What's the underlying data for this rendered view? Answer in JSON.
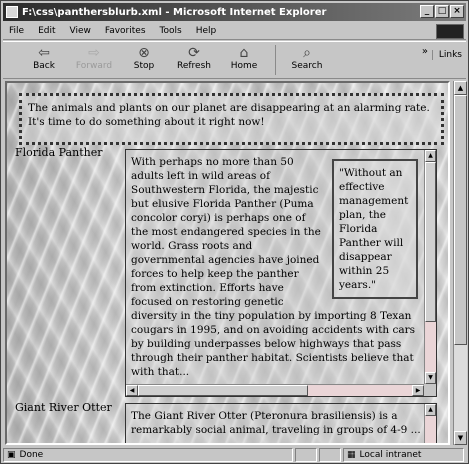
{
  "window": {
    "title": "F:\\css\\panthersblurb.xml - Microsoft Internet Explorer",
    "controls": [
      "_",
      "□",
      "×"
    ]
  },
  "menu": [
    "File",
    "Edit",
    "View",
    "Favorites",
    "Tools",
    "Help"
  ],
  "toolbar": {
    "back": "Back",
    "forward": "Forward",
    "stop": "Stop",
    "refresh": "Refresh",
    "home": "Home",
    "search": "Search",
    "more": "»",
    "links": "Links"
  },
  "page": {
    "intro": "The animals and plants on our planet are disappearing at an alarming rate. It's time to do something about it right now!",
    "sections": [
      {
        "label": "Florida Panther",
        "quote": "\"Without an effective management plan, the Florida Panther will disappear within 25 years.\"",
        "text": "With perhaps no more than 50 adults left in wild areas of Southwestern Florida, the majestic but elusive Florida Panther (Puma concolor coryi) is perhaps one of the most endangered species in the world. Grass roots and governmental agencies have joined forces to help keep the panther from extinction. Efforts have focused on restoring genetic diversity in the tiny population by importing 8 Texan cougars in 1995, and on avoiding accidents with cars by building underpasses below highways that pass through their panther habitat. Scientists believe that with that..."
      },
      {
        "label": "Giant River Otter",
        "text": "The Giant River Otter (Pteronura brasiliensis) is a remarkably social animal, traveling in groups of 4-9 ..."
      }
    ]
  },
  "status": {
    "left": "Done",
    "zone": "Local intranet"
  }
}
